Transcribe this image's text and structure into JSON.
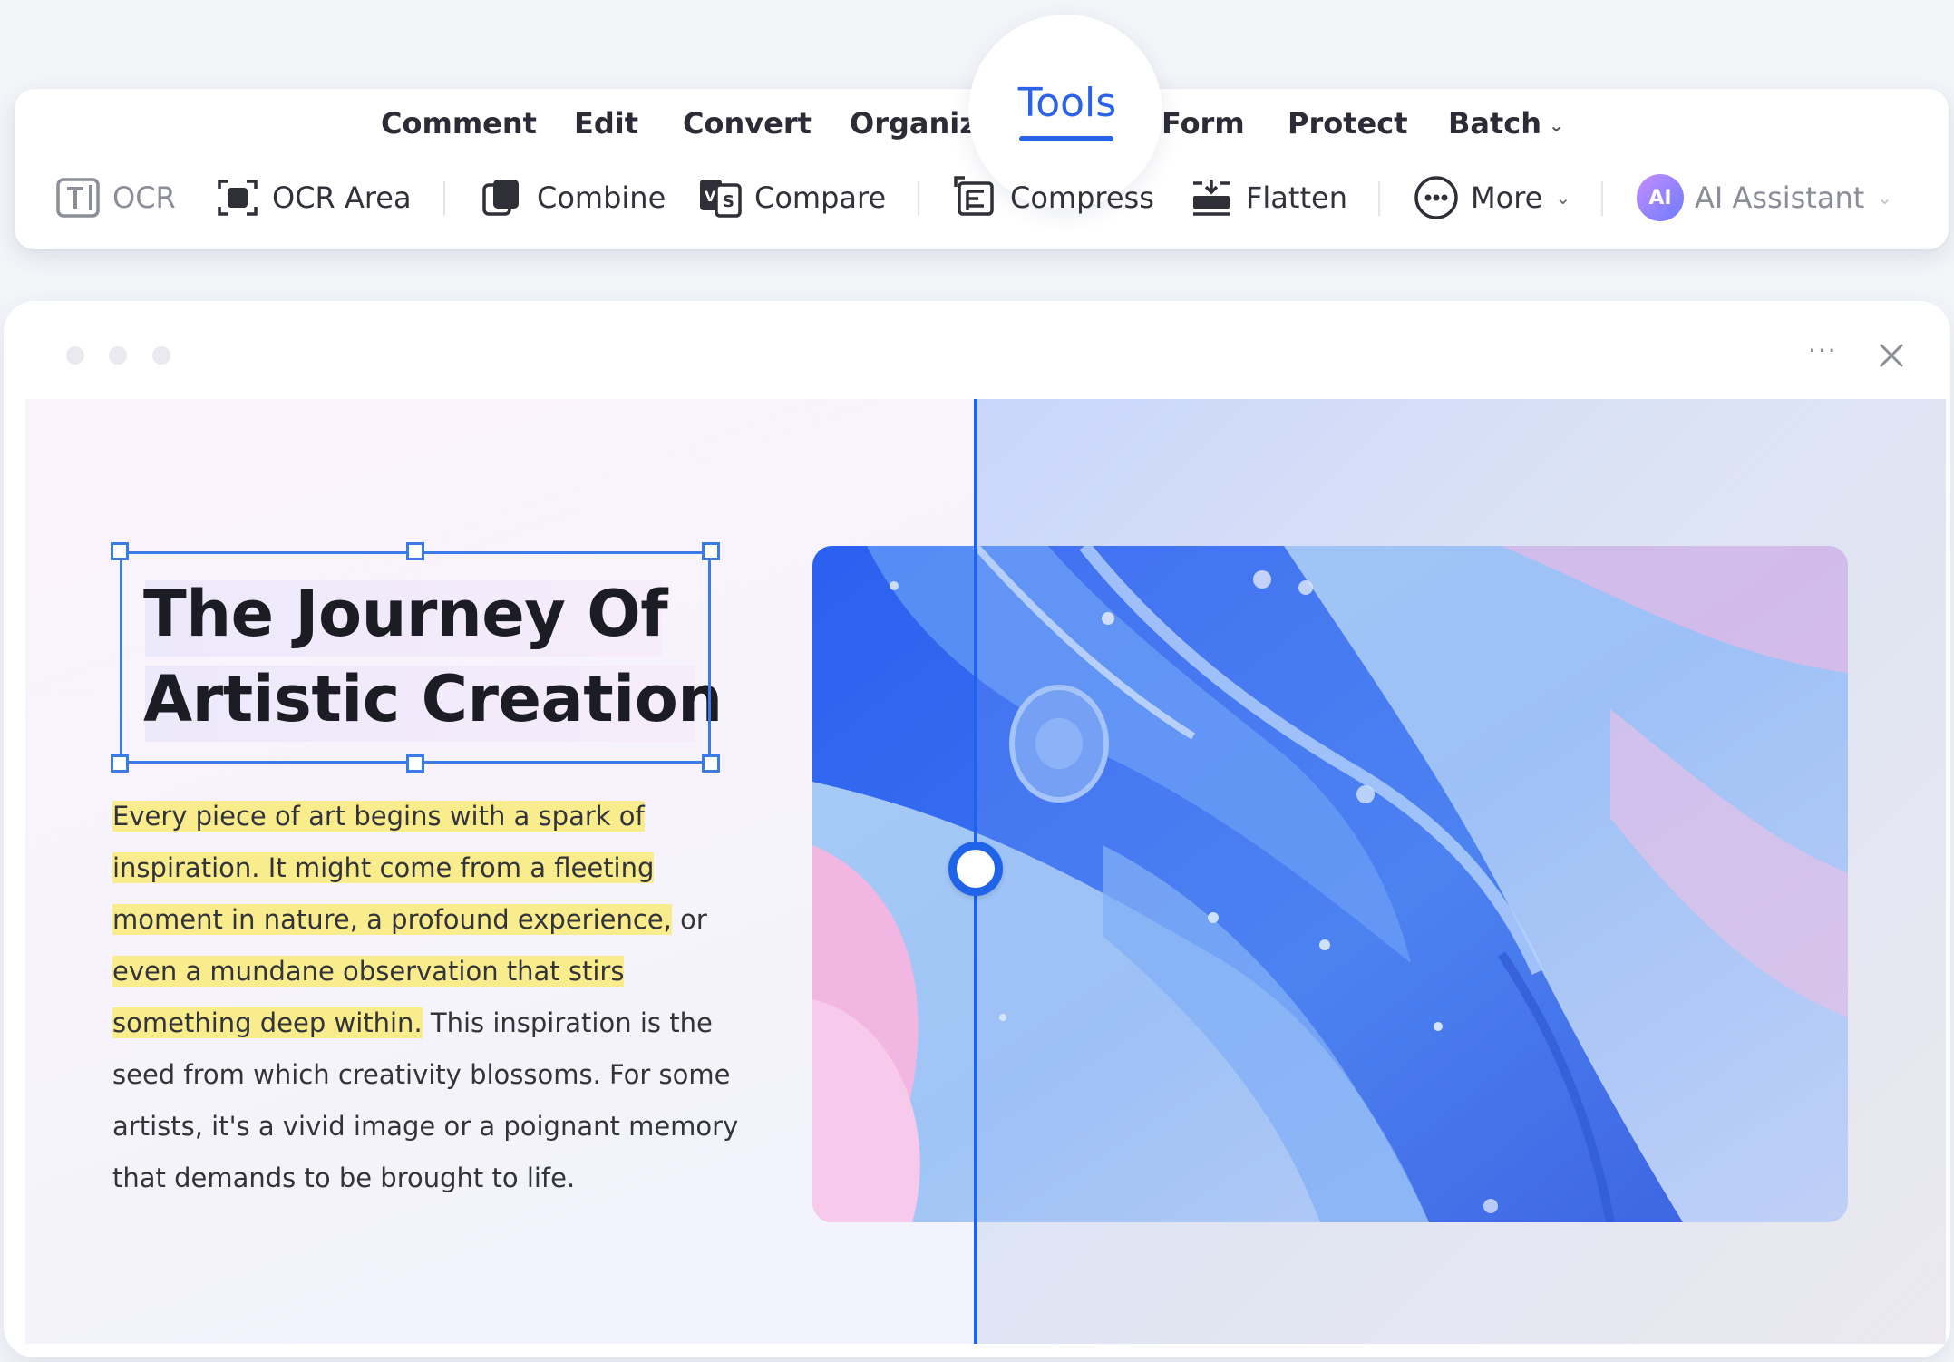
{
  "tabs": {
    "comment": "Comment",
    "edit": "Edit",
    "convert": "Convert",
    "organize": "Organize",
    "tools": "Tools",
    "form": "Form",
    "protect": "Protect",
    "batch": "Batch"
  },
  "tools": {
    "ocr": "OCR",
    "ocr_area": "OCR Area",
    "combine": "Combine",
    "compare": "Compare",
    "compress": "Compress",
    "flatten": "Flatten",
    "more": "More",
    "ai_badge": "AI",
    "ai_assistant": "AI Assistant"
  },
  "window": {
    "more_label": "···"
  },
  "document": {
    "title_line1": "The Journey Of",
    "title_line2": "Artistic Creation",
    "body": {
      "p1": "Every piece of art begins with a spark of",
      "p2": "inspiration. It might come from a fleeting",
      "p3": "moment in nature, a profound experience,",
      "p3_rest": " or",
      "p4": "even a mundane observation that stirs",
      "p5": "something deep within.",
      "p5_rest": " This inspiration is the",
      "p6": "seed from which creativity blossoms. For some",
      "p7": "artists, it's a vivid image or a poignant memory",
      "p8": "that demands to be brought to life."
    }
  },
  "colors": {
    "accent": "#2a62e8",
    "highlight": "#f8ec8c",
    "selection": "#3a7be8"
  }
}
